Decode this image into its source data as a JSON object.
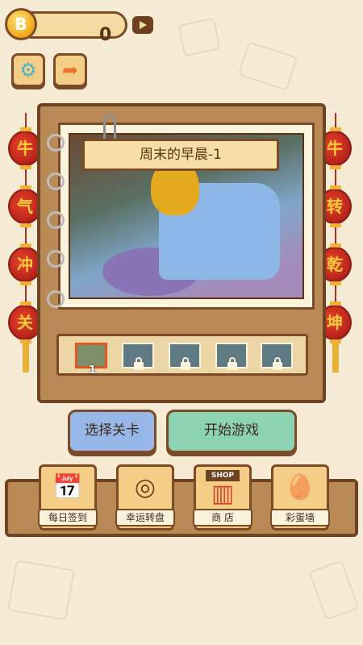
{
  "top_bar": {
    "coin_symbol": "B",
    "coin_count": "0"
  },
  "lanterns": {
    "left": [
      "牛",
      "气",
      "冲",
      "关"
    ],
    "right": [
      "牛",
      "转",
      "乾",
      "坤"
    ]
  },
  "level": {
    "title": "周末的早晨-1",
    "selected_index": "1"
  },
  "buttons": {
    "select_level": "选择关卡",
    "start_game": "开始游戏"
  },
  "menu": {
    "daily_checkin": "每日签到",
    "lucky_wheel": "幸运转盘",
    "shop": "商 店",
    "shop_sign": "SHOP",
    "easter_egg_wall": "彩蛋墙"
  }
}
